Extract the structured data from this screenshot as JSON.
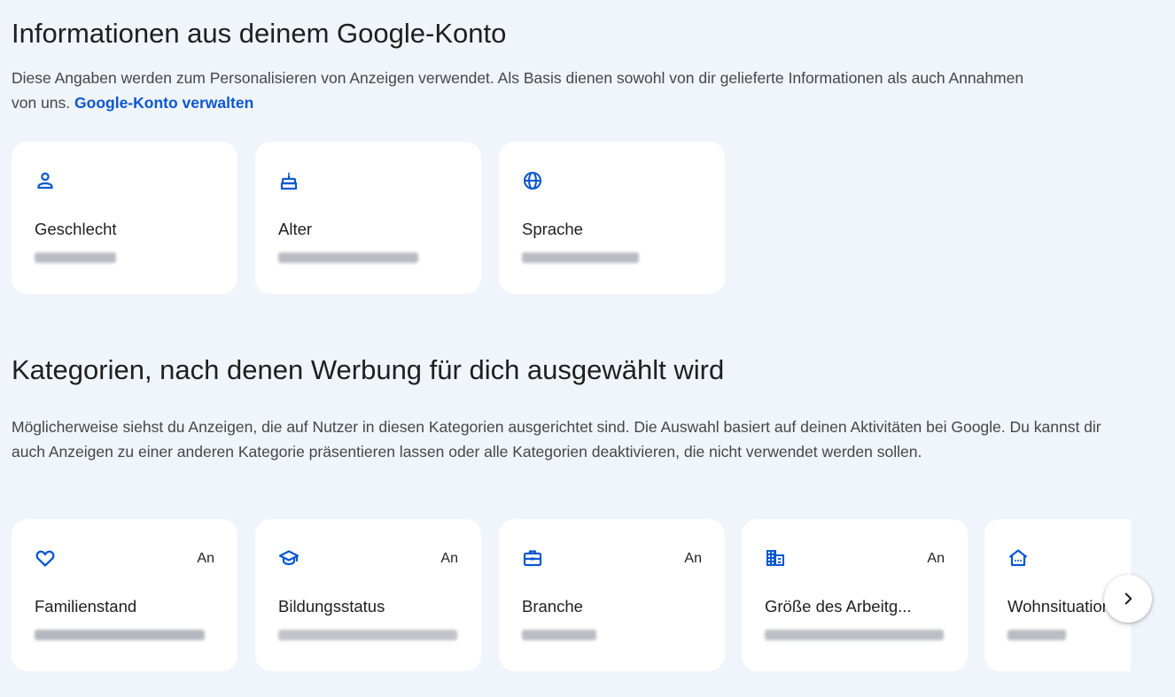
{
  "account_section": {
    "title": "Informationen aus deinem Google-Konto",
    "description": "Diese Angaben werden zum Personalisieren von Anzeigen verwendet. Als Basis dienen sowohl von dir gelieferte Informationen als auch Annahmen von uns.",
    "manage_link": "Google-Konto verwalten",
    "cards": [
      {
        "label": "Geschlecht",
        "icon": "person-icon",
        "value_blurred": true
      },
      {
        "label": "Alter",
        "icon": "cake-icon",
        "value_blurred": true
      },
      {
        "label": "Sprache",
        "icon": "globe-icon",
        "value_blurred": true
      }
    ]
  },
  "categories_section": {
    "title": "Kategorien, nach denen Werbung für dich ausgewählt wird",
    "description": "Möglicherweise siehst du Anzeigen, die auf Nutzer in diesen Kategorien ausgerichtet sind. Die Auswahl basiert auf deinen Aktivitäten bei Google. Du kannst dir auch Anzeigen zu einer anderen Kategorie präsentieren lassen oder alle Kategorien deaktivieren, die nicht verwendet werden sollen.",
    "cards": [
      {
        "label": "Familienstand",
        "status": "An",
        "icon": "heart-icon",
        "value_blurred": true
      },
      {
        "label": "Bildungsstatus",
        "status": "An",
        "icon": "graduation-cap-icon",
        "value_blurred": true
      },
      {
        "label": "Branche",
        "status": "An",
        "icon": "briefcase-icon",
        "value_blurred": true
      },
      {
        "label": "Größe des Arbeitg...",
        "status": "An",
        "icon": "building-icon",
        "value_blurred": true
      },
      {
        "label": "Wohnsituation",
        "status": "",
        "icon": "home-icon",
        "value_blurred": true
      }
    ]
  },
  "colors": {
    "background": "#f0f4fb",
    "card": "#ffffff",
    "accent": "#0b57d0",
    "text": "#1f1f1f",
    "secondary_text": "#444746"
  },
  "carousel": {
    "next_icon": "chevron-right-icon"
  }
}
